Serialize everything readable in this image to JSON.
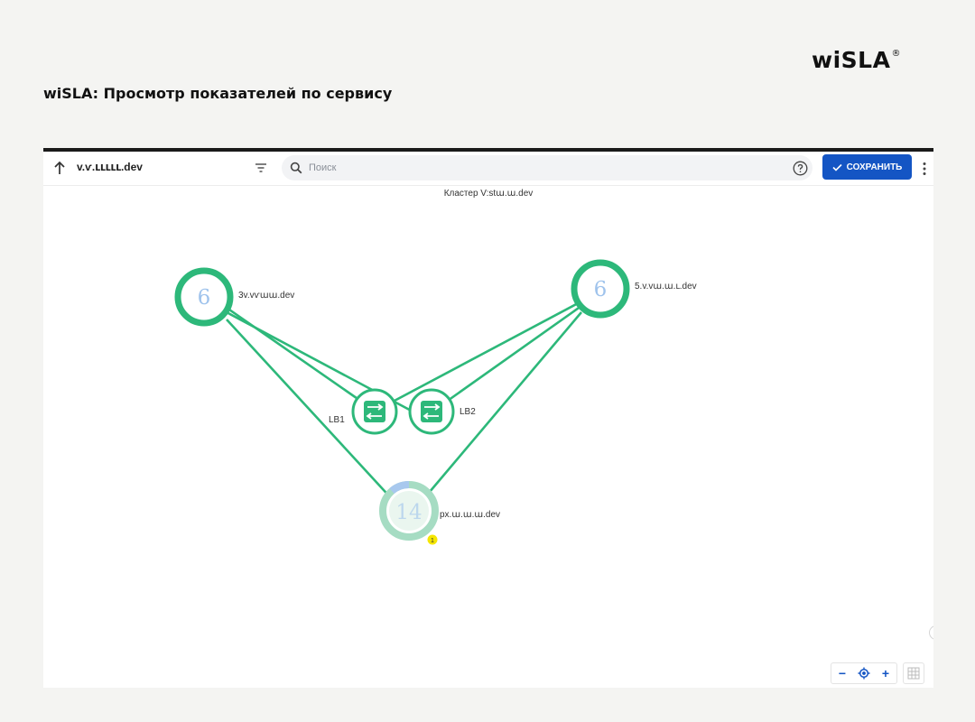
{
  "brand": {
    "logo_text": "wiSLA",
    "logo_mark": "®"
  },
  "page": {
    "heading": "wiSLA: Просмотр показателей по сервису"
  },
  "toolbar": {
    "service_name": "v.ѵ.ւււււ.dev",
    "search_placeholder": "Поиск",
    "save_label": "СОХРАНИТЬ",
    "icons": {
      "up": "arrow-up-icon",
      "filter": "filter-icon",
      "search": "search-icon",
      "help": "help-icon",
      "save": "check-icon",
      "more": "more-vertical-icon"
    }
  },
  "graph": {
    "title": "Кластер V:stա.ա.dev",
    "nodes": {
      "server_left": {
        "label": "3v.vѵաա.dev",
        "count": "6"
      },
      "server_right": {
        "label": "5.v.vա.ա.ւ.dev",
        "count": "6"
      },
      "lb1": {
        "label": "LB1",
        "icon": "load-balancer-icon"
      },
      "lb2": {
        "label": "LB2",
        "icon": "load-balancer-icon"
      },
      "server_bottom": {
        "label": "px.ա.ա.ա.dev",
        "count": "14",
        "alert_badge": "1"
      }
    },
    "colors": {
      "healthy": "#2db87a",
      "healthy_light": "#a6dcc3",
      "count_text": "#9fc3ec",
      "alert": "#f5e600",
      "accent": "#1455c4"
    }
  },
  "zoom_controls": {
    "zoom_out": "−",
    "zoom_in": "+",
    "icons": {
      "center": "locate-icon",
      "grid": "grid-icon"
    }
  }
}
